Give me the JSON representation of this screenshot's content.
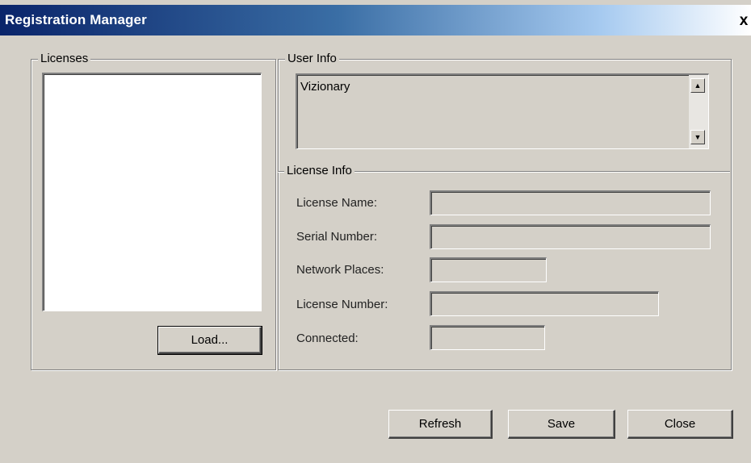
{
  "window": {
    "title": "Registration Manager",
    "close_glyph": "x"
  },
  "licenses": {
    "group_label": "Licenses",
    "load_button": "Load..."
  },
  "user_info": {
    "group_label": "User Info",
    "value": "Vizionary",
    "scroll_up_glyph": "▲",
    "scroll_down_glyph": "▼"
  },
  "license_info": {
    "group_label": "License Info",
    "fields": [
      {
        "label": "License Name:",
        "value": ""
      },
      {
        "label": "Serial Number:",
        "value": ""
      },
      {
        "label": "Network Places:",
        "value": ""
      },
      {
        "label": "License Number:",
        "value": ""
      },
      {
        "label": "Connected:",
        "value": ""
      }
    ]
  },
  "footer": {
    "refresh_button": "Refresh",
    "save_button": "Save",
    "close_button": "Close"
  },
  "icons": {
    "close": "close-icon",
    "scroll_up": "chevron-up-icon",
    "scroll_down": "chevron-down-icon"
  }
}
